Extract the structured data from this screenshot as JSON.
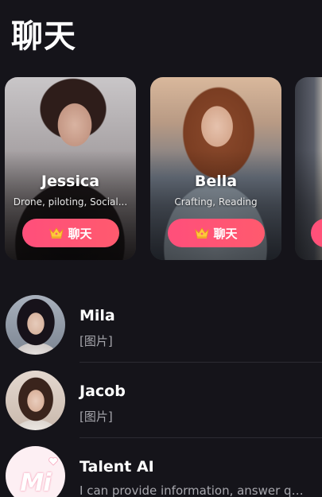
{
  "header": {
    "title": "聊天"
  },
  "featured": [
    {
      "name": "Jessica",
      "tags": "Drone, piloting, Social...",
      "chat_label": "聊天"
    },
    {
      "name": "Bella",
      "tags": "Crafting, Reading",
      "chat_label": "聊天"
    },
    {
      "name": "",
      "tags": "",
      "chat_label": ""
    }
  ],
  "conversations": [
    {
      "name": "Mila",
      "preview": "[图片]"
    },
    {
      "name": "Jacob",
      "preview": "[图片]"
    },
    {
      "name": "Talent AI",
      "preview": "I can provide information, answer qu...",
      "logo_text": "Mi"
    }
  ],
  "colors": {
    "background": "#15141a",
    "accent": "#ff4f7b",
    "secondary_text": "#a7a7ad",
    "divider": "#2c2b33"
  },
  "icons": {
    "chat_button": "crown-icon"
  }
}
